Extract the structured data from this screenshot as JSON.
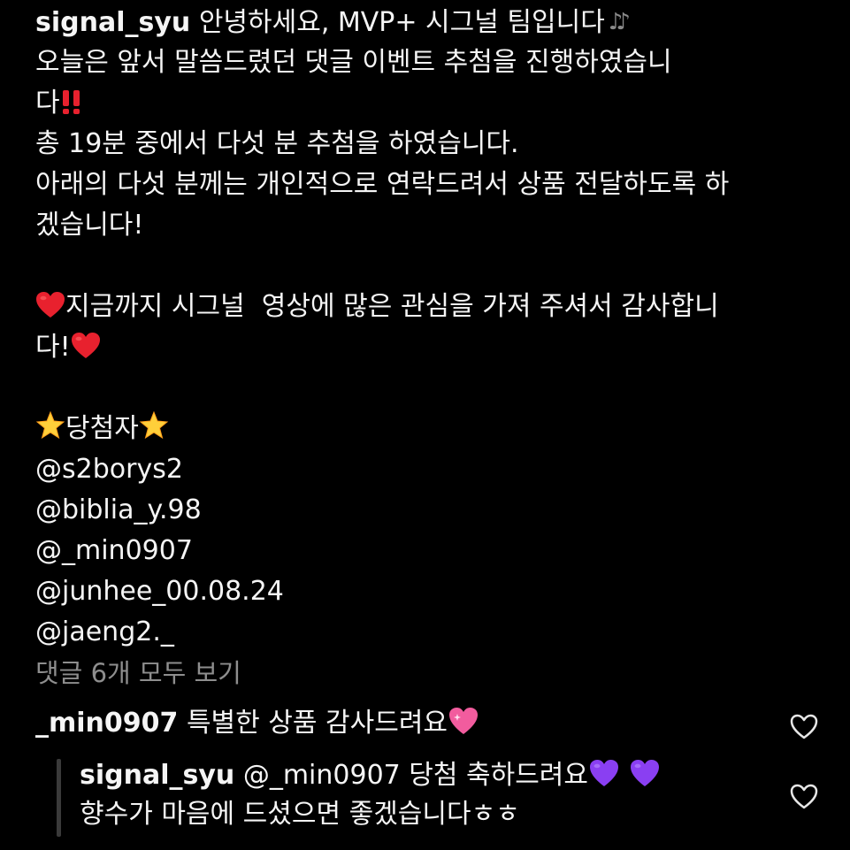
{
  "post": {
    "username": "signal_syu",
    "caption_line1": " 안녕하세요, MVP+ 시그널 팀입니다",
    "music_emoji": "🎶",
    "caption_line2": "오늘은 앞서 말씀드렸던 댓글 이벤트 추첨을 진행하였습니",
    "caption_line3": "다",
    "caption_line4": "총 19분 중에서 다섯 분 추첨을 하였습니다.",
    "caption_line5": "아래의 다섯 분께는 개인적으로 연락드려서 상품 전달하도록 하",
    "caption_line6": "겠습니다!",
    "caption_line7": "지금까지 시그널  영상에 많은 관심을 가져 주셔서 감사합니",
    "caption_line8": "다!",
    "winners_title": "당첨자",
    "winners": [
      "@s2borys2",
      "@biblia_y.98",
      "@_min0907",
      "@junhee_00.08.24",
      "@jaeng2._"
    ]
  },
  "view_all_comments": "댓글 6개 모두 보기",
  "comment": {
    "username": "_min0907",
    "text": " 특별한 상품 감사드려요"
  },
  "reply": {
    "username": "signal_syu",
    "text_line1": " @_min0907 당첨 축하드려요",
    "text_line2": "향수가 마음에 드셨으면 좋겠습니다ㅎㅎ"
  },
  "icons": {
    "like": "heart-outline-icon",
    "red_heart": "red-heart-emoji",
    "exclamation": "double-exclamation-emoji",
    "glowing_star": "glowing-star-emoji",
    "sparkling_heart": "sparkling-heart-emoji",
    "purple_heart": "purple-heart-emoji"
  },
  "colors": {
    "background": "#000000",
    "text": "#f5f5f5",
    "muted": "#8e8e8e",
    "red": "#e8212e",
    "purple": "#8a3ff2",
    "pink": "#f25c9e"
  }
}
